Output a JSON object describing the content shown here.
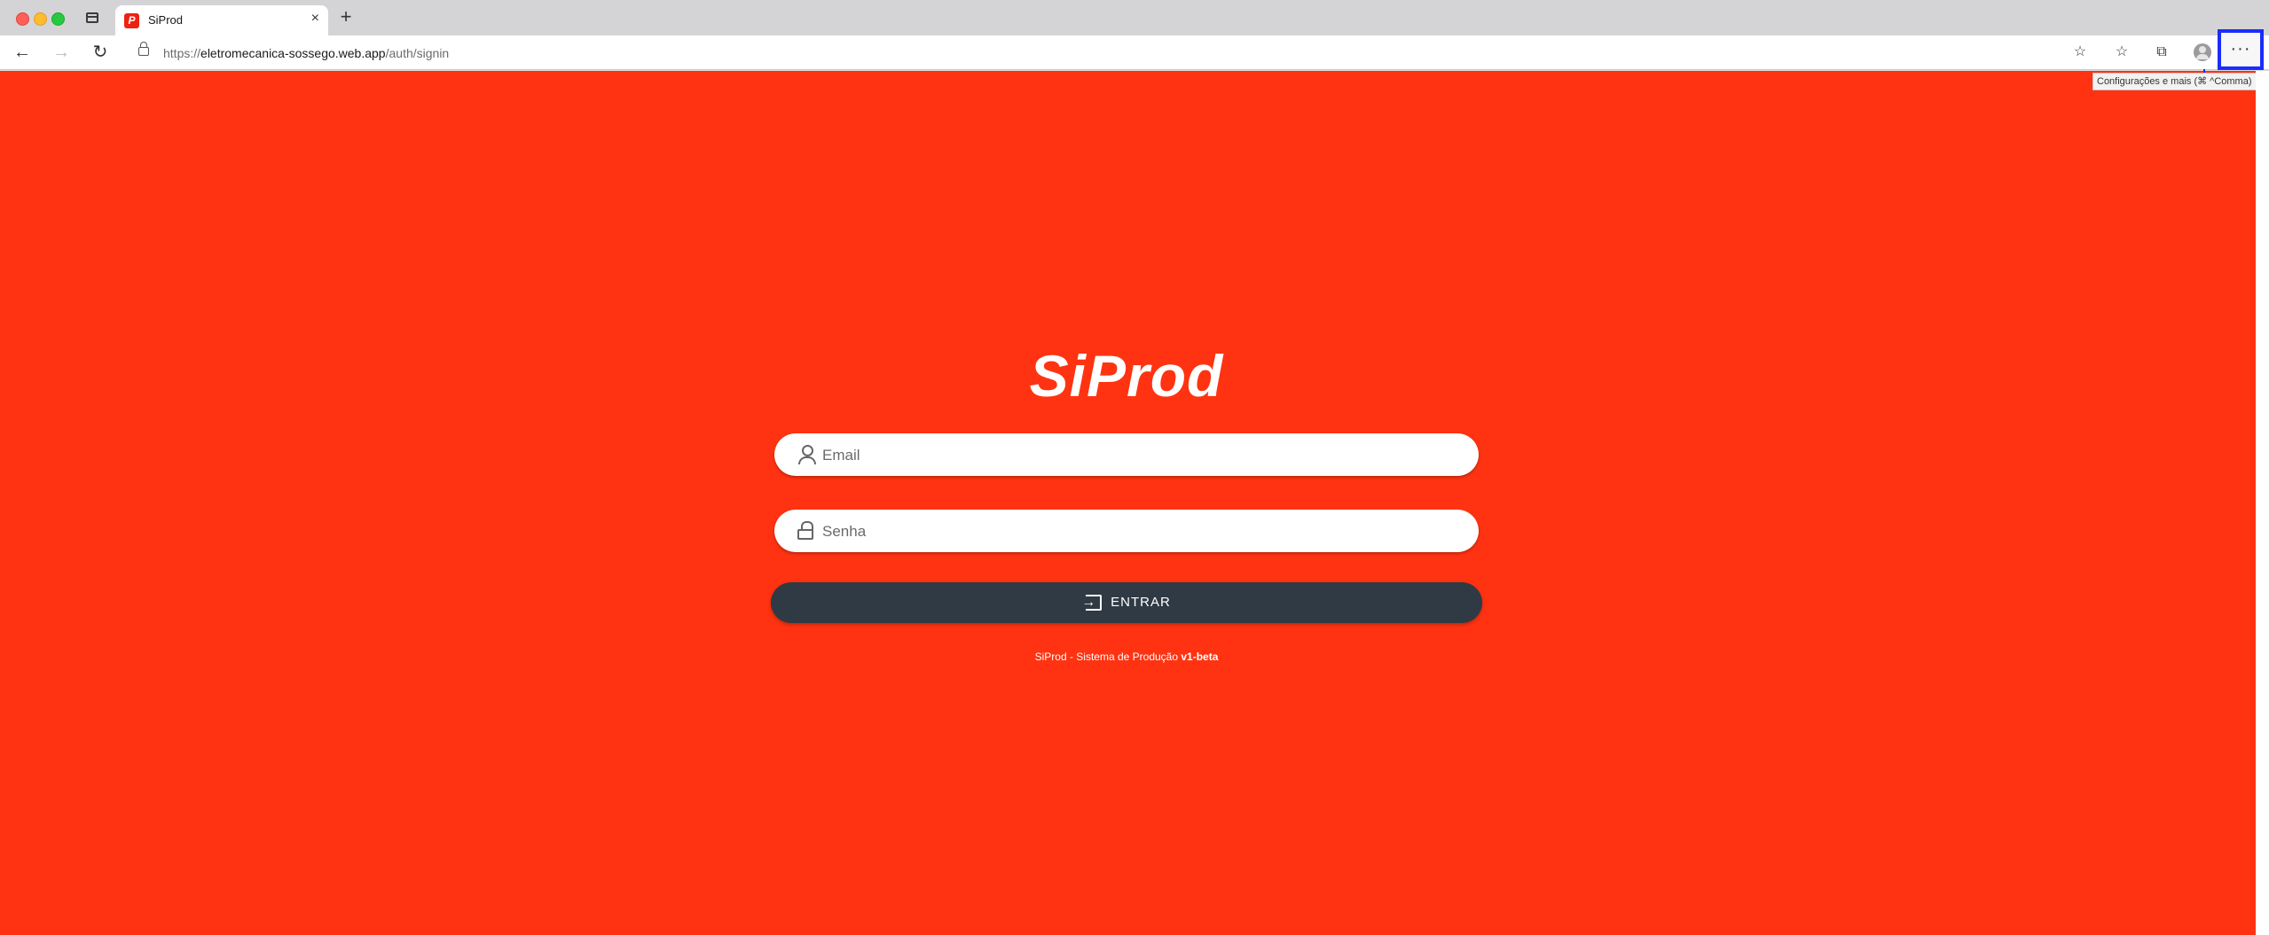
{
  "browser": {
    "tab_title": "SiProd",
    "tab_close": "×",
    "new_tab": "+",
    "url": {
      "scheme": "https://",
      "host": "eletromecanica-sossego.web.app",
      "path": "/auth/signin"
    },
    "more_button": "···",
    "tooltip": "Configurações e mais (⌘ ^Comma)"
  },
  "login": {
    "logo_text": "SiProd",
    "email_placeholder": "Email",
    "senha_placeholder": "Senha",
    "submit_label": "ENTRAR",
    "footer_text": "SiProd - Sistema de Produção",
    "footer_version": "v1-beta"
  },
  "colors": {
    "background": "#ff3311",
    "button": "#2f3a44",
    "highlight": "#1a2dff"
  }
}
